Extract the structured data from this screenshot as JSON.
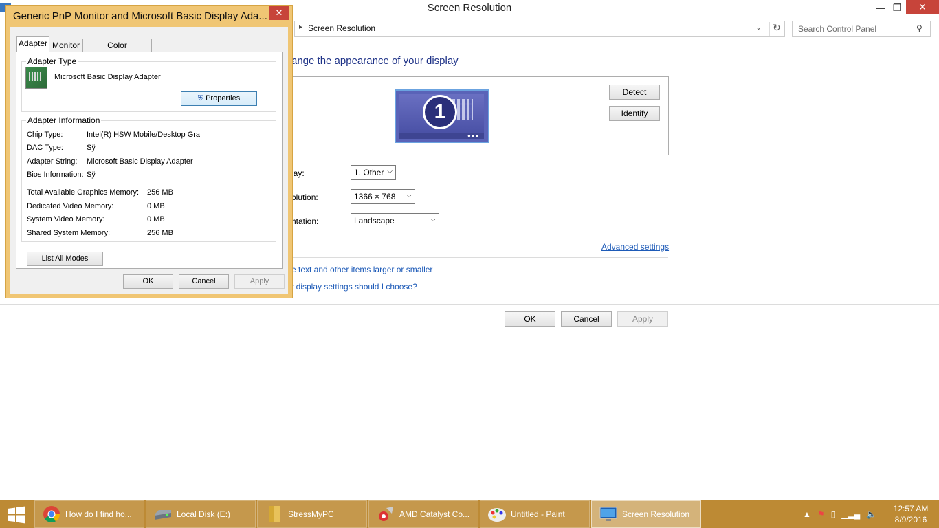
{
  "window": {
    "title": "Screen Resolution",
    "address": "Screen Resolution",
    "search_placeholder": "Search Control Panel",
    "heading": "ange the appearance of your display",
    "detect": "Detect",
    "identify": "Identify",
    "monitor_number": "1",
    "display_label": "lay:",
    "display_value": "1. Other",
    "resolution_label": "olution:",
    "resolution_value": "1366 × 768",
    "orientation_label": "ntation:",
    "orientation_value": "Landscape",
    "advanced": "Advanced settings",
    "link1": "e text and other items larger or smaller",
    "link2": "t display settings should I choose?",
    "ok": "OK",
    "cancel": "Cancel",
    "apply": "Apply"
  },
  "dialog": {
    "title": "Generic PnP Monitor and Microsoft Basic Display Ada...",
    "close": "✕",
    "tabs": [
      "Adapter",
      "Monitor",
      "Color Management"
    ],
    "adapter_type_label": "Adapter Type",
    "adapter_name": "Microsoft Basic Display Adapter",
    "properties": "Properties",
    "adapter_info_label": "Adapter Information",
    "info": [
      {
        "k": "Chip Type:",
        "v": "Intel(R) HSW Mobile/Desktop Gra"
      },
      {
        "k": "DAC Type:",
        "v": "Sÿ"
      },
      {
        "k": "Adapter String:",
        "v": "Microsoft Basic Display Adapter"
      },
      {
        "k": "Bios Information:",
        "v": "Sÿ"
      }
    ],
    "memory": [
      {
        "k": "Total Available Graphics Memory:",
        "v": "256 MB"
      },
      {
        "k": "Dedicated Video Memory:",
        "v": "0 MB"
      },
      {
        "k": "System Video Memory:",
        "v": "0 MB"
      },
      {
        "k": "Shared System Memory:",
        "v": "256 MB"
      }
    ],
    "list_modes": "List All Modes",
    "ok": "OK",
    "cancel": "Cancel",
    "apply": "Apply"
  },
  "taskbar": {
    "items": [
      {
        "label": "How do I find ho...",
        "icon": "chrome-icon"
      },
      {
        "label": "Local Disk (E:)",
        "icon": "drive-icon"
      },
      {
        "label": "StressMyPC",
        "icon": "folder-icon"
      },
      {
        "label": "AMD Catalyst Co...",
        "icon": "amd-icon"
      },
      {
        "label": "Untitled - Paint",
        "icon": "paint-icon"
      },
      {
        "label": "Screen Resolution",
        "icon": "display-icon"
      }
    ],
    "time": "12:57 AM",
    "date": "8/9/2016"
  }
}
